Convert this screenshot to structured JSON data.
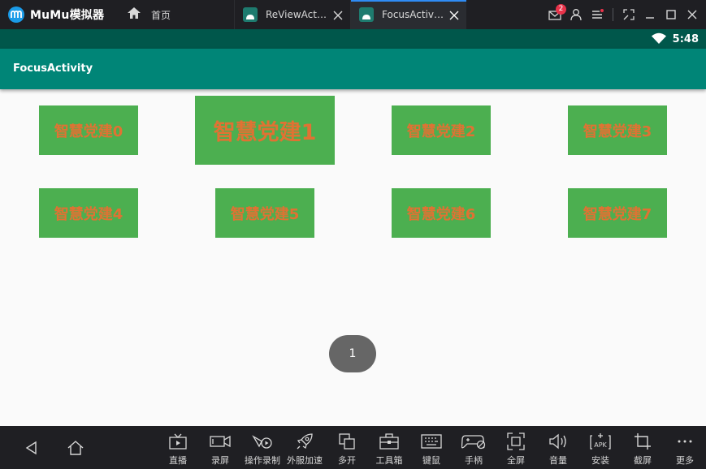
{
  "titlebar": {
    "app_name": "MuMu模拟器",
    "home_tab_label": "首页",
    "tabs": [
      {
        "label": "ReViewActi…",
        "active": false
      },
      {
        "label": "FocusActivity",
        "active": true
      }
    ],
    "mail_badge": "2"
  },
  "android": {
    "status_time": "5:48",
    "app_title": "FocusActivity",
    "focused_index": 1,
    "cells": [
      "智慧党建0",
      "智慧党建1",
      "智慧党建2",
      "智慧党建3",
      "智慧党建4",
      "智慧党建5",
      "智慧党建6",
      "智慧党建7"
    ],
    "toast_text": "1"
  },
  "toolbar": {
    "tools": [
      {
        "label": "直播",
        "icon": "live-tv-icon"
      },
      {
        "label": "录屏",
        "icon": "record-screen-icon"
      },
      {
        "label": "操作录制",
        "icon": "macro-record-icon"
      },
      {
        "label": "外服加速",
        "icon": "rocket-boost-icon"
      },
      {
        "label": "多开",
        "icon": "multi-instance-icon"
      },
      {
        "label": "工具箱",
        "icon": "toolbox-icon"
      },
      {
        "label": "键鼠",
        "icon": "keyboard-icon"
      },
      {
        "label": "手柄",
        "icon": "gamepad-icon"
      },
      {
        "label": "全屏",
        "icon": "fullscreen-icon"
      },
      {
        "label": "音量",
        "icon": "volume-icon"
      },
      {
        "label": "安装",
        "icon": "install-apk-icon"
      },
      {
        "label": "截屏",
        "icon": "crop-screenshot-icon"
      },
      {
        "label": "更多",
        "icon": "more-icon"
      }
    ]
  },
  "colors": {
    "status_bar": "#00574b",
    "app_bar": "#008577",
    "cell_bg": "#4caf50",
    "cell_text": "#e07233",
    "tab_accent": "#2f8cf5"
  }
}
